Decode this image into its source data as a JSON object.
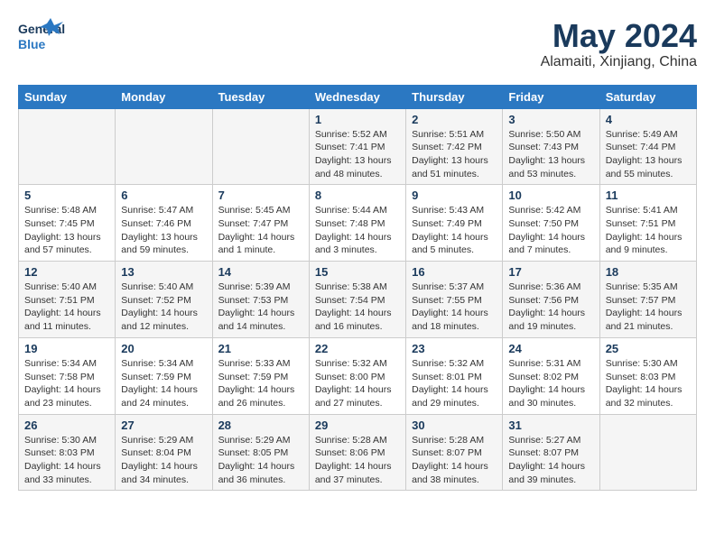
{
  "logo": {
    "line1": "General",
    "line2": "Blue"
  },
  "title": "May 2024",
  "subtitle": "Alamaiti, Xinjiang, China",
  "weekdays": [
    "Sunday",
    "Monday",
    "Tuesday",
    "Wednesday",
    "Thursday",
    "Friday",
    "Saturday"
  ],
  "weeks": [
    [
      null,
      null,
      null,
      {
        "day": 1,
        "sunrise": "5:52 AM",
        "sunset": "7:41 PM",
        "daylight": "13 hours and 48 minutes."
      },
      {
        "day": 2,
        "sunrise": "5:51 AM",
        "sunset": "7:42 PM",
        "daylight": "13 hours and 51 minutes."
      },
      {
        "day": 3,
        "sunrise": "5:50 AM",
        "sunset": "7:43 PM",
        "daylight": "13 hours and 53 minutes."
      },
      {
        "day": 4,
        "sunrise": "5:49 AM",
        "sunset": "7:44 PM",
        "daylight": "13 hours and 55 minutes."
      }
    ],
    [
      {
        "day": 5,
        "sunrise": "5:48 AM",
        "sunset": "7:45 PM",
        "daylight": "13 hours and 57 minutes."
      },
      {
        "day": 6,
        "sunrise": "5:47 AM",
        "sunset": "7:46 PM",
        "daylight": "13 hours and 59 minutes."
      },
      {
        "day": 7,
        "sunrise": "5:45 AM",
        "sunset": "7:47 PM",
        "daylight": "14 hours and 1 minute."
      },
      {
        "day": 8,
        "sunrise": "5:44 AM",
        "sunset": "7:48 PM",
        "daylight": "14 hours and 3 minutes."
      },
      {
        "day": 9,
        "sunrise": "5:43 AM",
        "sunset": "7:49 PM",
        "daylight": "14 hours and 5 minutes."
      },
      {
        "day": 10,
        "sunrise": "5:42 AM",
        "sunset": "7:50 PM",
        "daylight": "14 hours and 7 minutes."
      },
      {
        "day": 11,
        "sunrise": "5:41 AM",
        "sunset": "7:51 PM",
        "daylight": "14 hours and 9 minutes."
      }
    ],
    [
      {
        "day": 12,
        "sunrise": "5:40 AM",
        "sunset": "7:51 PM",
        "daylight": "14 hours and 11 minutes."
      },
      {
        "day": 13,
        "sunrise": "5:40 AM",
        "sunset": "7:52 PM",
        "daylight": "14 hours and 12 minutes."
      },
      {
        "day": 14,
        "sunrise": "5:39 AM",
        "sunset": "7:53 PM",
        "daylight": "14 hours and 14 minutes."
      },
      {
        "day": 15,
        "sunrise": "5:38 AM",
        "sunset": "7:54 PM",
        "daylight": "14 hours and 16 minutes."
      },
      {
        "day": 16,
        "sunrise": "5:37 AM",
        "sunset": "7:55 PM",
        "daylight": "14 hours and 18 minutes."
      },
      {
        "day": 17,
        "sunrise": "5:36 AM",
        "sunset": "7:56 PM",
        "daylight": "14 hours and 19 minutes."
      },
      {
        "day": 18,
        "sunrise": "5:35 AM",
        "sunset": "7:57 PM",
        "daylight": "14 hours and 21 minutes."
      }
    ],
    [
      {
        "day": 19,
        "sunrise": "5:34 AM",
        "sunset": "7:58 PM",
        "daylight": "14 hours and 23 minutes."
      },
      {
        "day": 20,
        "sunrise": "5:34 AM",
        "sunset": "7:59 PM",
        "daylight": "14 hours and 24 minutes."
      },
      {
        "day": 21,
        "sunrise": "5:33 AM",
        "sunset": "7:59 PM",
        "daylight": "14 hours and 26 minutes."
      },
      {
        "day": 22,
        "sunrise": "5:32 AM",
        "sunset": "8:00 PM",
        "daylight": "14 hours and 27 minutes."
      },
      {
        "day": 23,
        "sunrise": "5:32 AM",
        "sunset": "8:01 PM",
        "daylight": "14 hours and 29 minutes."
      },
      {
        "day": 24,
        "sunrise": "5:31 AM",
        "sunset": "8:02 PM",
        "daylight": "14 hours and 30 minutes."
      },
      {
        "day": 25,
        "sunrise": "5:30 AM",
        "sunset": "8:03 PM",
        "daylight": "14 hours and 32 minutes."
      }
    ],
    [
      {
        "day": 26,
        "sunrise": "5:30 AM",
        "sunset": "8:03 PM",
        "daylight": "14 hours and 33 minutes."
      },
      {
        "day": 27,
        "sunrise": "5:29 AM",
        "sunset": "8:04 PM",
        "daylight": "14 hours and 34 minutes."
      },
      {
        "day": 28,
        "sunrise": "5:29 AM",
        "sunset": "8:05 PM",
        "daylight": "14 hours and 36 minutes."
      },
      {
        "day": 29,
        "sunrise": "5:28 AM",
        "sunset": "8:06 PM",
        "daylight": "14 hours and 37 minutes."
      },
      {
        "day": 30,
        "sunrise": "5:28 AM",
        "sunset": "8:07 PM",
        "daylight": "14 hours and 38 minutes."
      },
      {
        "day": 31,
        "sunrise": "5:27 AM",
        "sunset": "8:07 PM",
        "daylight": "14 hours and 39 minutes."
      },
      null
    ]
  ],
  "labels": {
    "sunrise": "Sunrise:",
    "sunset": "Sunset:",
    "daylight": "Daylight:"
  }
}
